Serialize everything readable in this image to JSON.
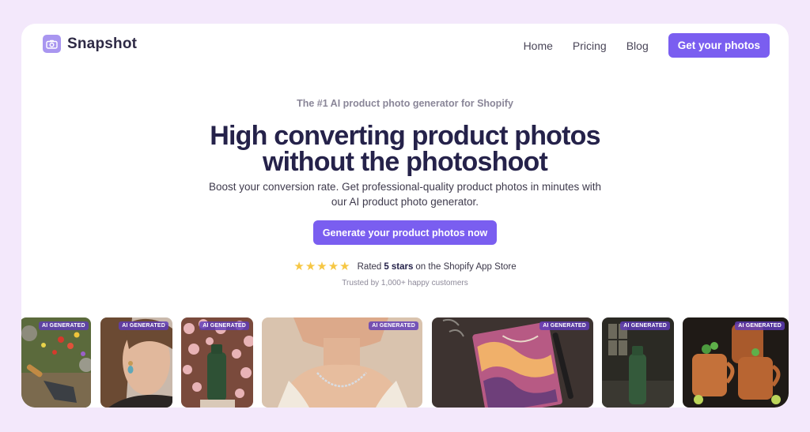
{
  "brand": {
    "name": "Snapshot",
    "logo_icon": "camera-icon",
    "accent": "#7a5ef0"
  },
  "nav": {
    "links": [
      "Home",
      "Pricing",
      "Blog"
    ],
    "cta_label": "Get your photos"
  },
  "hero": {
    "eyebrow": "The #1 AI product photo generator for Shopify",
    "headline_line1": "High converting product photos",
    "headline_line2": "without the photoshoot",
    "sub_line1": "Boost your conversion rate. Get professional-quality product photos in minutes with",
    "sub_line2": "our AI product photo generator.",
    "cta_label": "Generate your product photos now"
  },
  "rating": {
    "stars": 5,
    "prefix": "Rated",
    "highlight": "5 stars",
    "suffix": "on the Shopify App Store",
    "trusted": "Trusted by 1,000+ happy customers"
  },
  "gallery": {
    "badge": "AI GENERATED",
    "items": [
      {
        "subject": "garden trowel in flower bed"
      },
      {
        "subject": "woman wearing drop earring"
      },
      {
        "subject": "green bottle with pink blossoms"
      },
      {
        "subject": "woman wearing necklace"
      },
      {
        "subject": "marbled notebook with pen"
      },
      {
        "subject": "green bottle in dark interior"
      },
      {
        "subject": "copper mugs with cocktails"
      }
    ]
  }
}
